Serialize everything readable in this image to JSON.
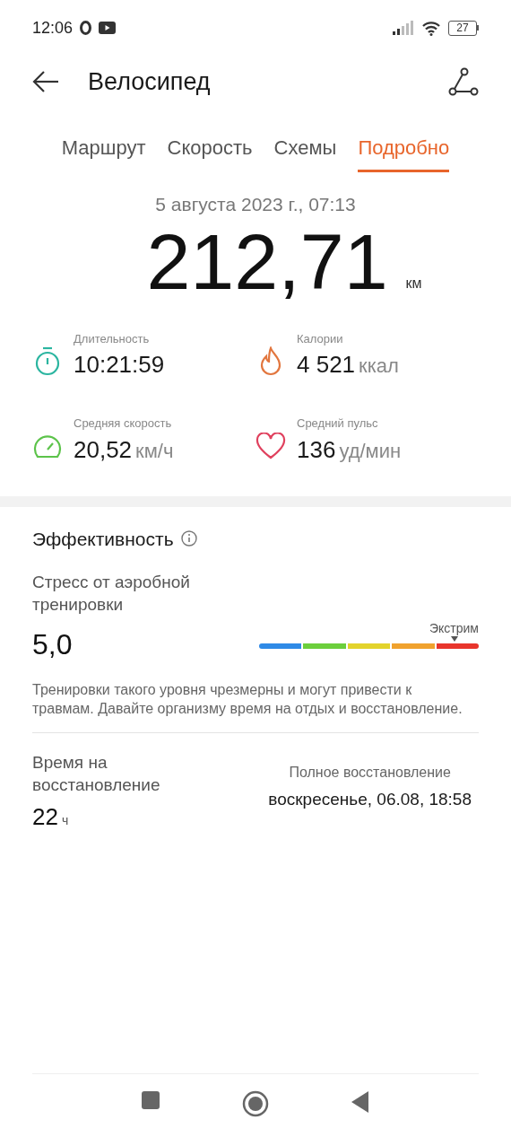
{
  "status_bar": {
    "time": "12:06",
    "battery": "27"
  },
  "header": {
    "title": "Велосипед"
  },
  "tabs": [
    {
      "label": "Маршрут",
      "selected": false
    },
    {
      "label": "Скорость",
      "selected": false
    },
    {
      "label": "Схемы",
      "selected": false
    },
    {
      "label": "Подробно",
      "selected": true
    }
  ],
  "date": "5 августа 2023 г., 07:13",
  "distance": {
    "value": "212,71",
    "unit": "км"
  },
  "stats": [
    {
      "kind": "duration",
      "label": "Длительность",
      "value": "10:21:59"
    },
    {
      "kind": "calories",
      "label": "Калории",
      "value": "4 521",
      "unit": "ккал"
    },
    {
      "kind": "speed",
      "label": "Средняя скорость",
      "value": "20,52",
      "unit": "км/ч"
    },
    {
      "kind": "heart",
      "label": "Средний пульс",
      "value": "136",
      "unit": "уд/мин"
    }
  ],
  "efficiency": {
    "title": "Эффективность",
    "stress": {
      "label": "Стресс от аэробной тренировки",
      "value": "5,0",
      "scale_label": "Экстрим",
      "level": 0.89
    },
    "description": "Тренировки такого уровня чрезмерны и могут привести к травмам. Давайте организму время на отдых и восстановление.",
    "recovery": {
      "label": "Время на восстановление",
      "value": "22",
      "unit": "ч",
      "full_label": "Полное восстановление",
      "full_value": "воскресенье, 06.08, 18:58"
    }
  }
}
